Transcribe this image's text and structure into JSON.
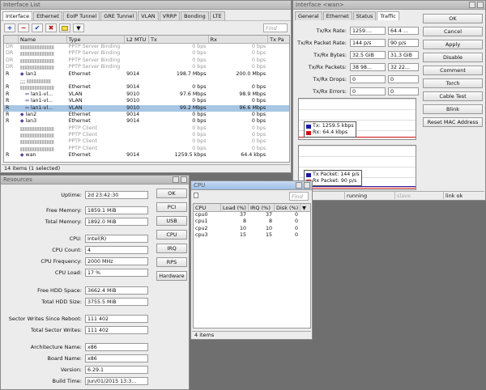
{
  "interface_list": {
    "title": "Interface List",
    "tabs": [
      "Interface",
      "Ethernet",
      "EoIP Tunnel",
      "GRE Tunnel",
      "VLAN",
      "VRRP",
      "Bonding",
      "LTE"
    ],
    "toolbar_icons": [
      "plus-icon",
      "minus-icon",
      "check-icon",
      "x-icon",
      "comment-icon",
      "filter-icon"
    ],
    "find_placeholder": "Find",
    "columns": [
      "Name",
      "Type",
      "L2 MTU",
      "Tx",
      "Rx",
      "Tx Pa"
    ],
    "rows": [
      {
        "flag": "DR",
        "name": "",
        "type": "PPTP Server Binding",
        "mtu": "",
        "tx": "0 bps",
        "rx": "0 bps",
        "blur": true,
        "dim": true
      },
      {
        "flag": "DR",
        "name": "",
        "type": "PPTP Server Binding",
        "mtu": "",
        "tx": "0 bps",
        "rx": "0 bps",
        "blur": true,
        "dim": true
      },
      {
        "flag": "DR",
        "name": "",
        "type": "PPTP Server Binding",
        "mtu": "",
        "tx": "0 bps",
        "rx": "0 bps",
        "blur": true,
        "dim": true
      },
      {
        "flag": "DR",
        "name": "",
        "type": "PPTP Server Binding",
        "mtu": "",
        "tx": "0 bps",
        "rx": "0 bps",
        "blur": true,
        "dim": true
      },
      {
        "flag": "R",
        "name": "lan1",
        "type": "Ethernet",
        "mtu": "9014",
        "tx": "198.7 Mbps",
        "rx": "200.0 Mbps",
        "icon": "ethernet"
      },
      {
        "flag": "",
        "name": ";;;",
        "type": "",
        "mtu": "",
        "tx": "",
        "rx": "",
        "blur": true
      },
      {
        "flag": "R",
        "name": "",
        "type": "Ethernet",
        "mtu": "9014",
        "tx": "0 bps",
        "rx": "0 bps",
        "blur": true
      },
      {
        "flag": "R",
        "name": "lan1-vl...",
        "type": "VLAN",
        "mtu": "9010",
        "tx": "97.6 Mbps",
        "rx": "98.9 Mbps",
        "icon": "vlan"
      },
      {
        "flag": "R",
        "name": "lan1-vl...",
        "type": "VLAN",
        "mtu": "9010",
        "tx": "0 bps",
        "rx": "0 bps",
        "icon": "vlan"
      },
      {
        "flag": "R",
        "name": "lan1-vl...",
        "type": "VLAN",
        "mtu": "9010",
        "tx": "99.2 Mbps",
        "rx": "96.6 Mbps",
        "icon": "vlan",
        "selected": true
      },
      {
        "flag": "R",
        "name": "lan2",
        "type": "Ethernet",
        "mtu": "9014",
        "tx": "0 bps",
        "rx": "0 bps",
        "icon": "ethernet"
      },
      {
        "flag": "R",
        "name": "lan3",
        "type": "Ethernet",
        "mtu": "9014",
        "tx": "0 bps",
        "rx": "0 bps",
        "icon": "ethernet"
      },
      {
        "flag": "",
        "name": "",
        "type": "PPTP Client",
        "mtu": "",
        "tx": "0 bps",
        "rx": "0 bps",
        "blur": true,
        "dim": true
      },
      {
        "flag": "",
        "name": "",
        "type": "PPTP Client",
        "mtu": "",
        "tx": "0 bps",
        "rx": "0 bps",
        "blur": true,
        "dim": true
      },
      {
        "flag": "",
        "name": "",
        "type": "PPTP Client",
        "mtu": "",
        "tx": "0 bps",
        "rx": "0 bps",
        "blur": true,
        "dim": true
      },
      {
        "flag": "",
        "name": "",
        "type": "PPTP Client",
        "mtu": "",
        "tx": "0 bps",
        "rx": "0 bps",
        "blur": true,
        "dim": true
      },
      {
        "flag": "R",
        "name": "wan",
        "type": "Ethernet",
        "mtu": "9014",
        "tx": "1259.5 kbps",
        "rx": "64.4 kbps",
        "icon": "ethernet"
      }
    ],
    "status": "14 items (1 selected)"
  },
  "interface_detail": {
    "title": "Interface <wan>",
    "tabs": [
      "General",
      "Ethernet",
      "Status",
      "Traffic"
    ],
    "fields": [
      {
        "label": "Tx/Rx Rate:",
        "a": "1259....",
        "b": "64.4 ..."
      },
      {
        "label": "Tx/Rx Packet Rate:",
        "a": "144 p/s",
        "b": "90 p/s"
      },
      {
        "label": "Tx/Rx Bytes:",
        "a": "32.5 GiB",
        "b": "31.3 GiB"
      },
      {
        "label": "Tx/Rx Packets:",
        "a": "38 98...",
        "b": "32 22..."
      },
      {
        "label": "Tx/Rx Drops:",
        "a": "0",
        "b": "0"
      },
      {
        "label": "Tx/Rx Errors:",
        "a": "0",
        "b": "0"
      }
    ],
    "buttons": [
      "OK",
      "Cancel",
      "Apply",
      "Disable",
      "Comment",
      "Torch",
      "Cable Test",
      "Blink",
      "Reset MAC Address"
    ],
    "graph1_legend": [
      {
        "label": "Tx:   1259.5 kbps",
        "color": "#1a1aa0"
      },
      {
        "label": "Rx:   64.4 kbps",
        "color": "#d01010"
      }
    ],
    "graph2_legend": [
      {
        "label": "Tx Packet:  144 p/s",
        "color": "#1a1aa0"
      },
      {
        "label": "Rx Packet:  90 p/s",
        "color": "#d01010"
      }
    ],
    "status": [
      "d",
      "running",
      "slave",
      "link ok"
    ]
  },
  "resources": {
    "title": "Resources",
    "fields": [
      {
        "label": "Uptime:",
        "value": "2d 23:42:30"
      },
      {
        "label": "Free Memory:",
        "value": "1859.1 MiB"
      },
      {
        "label": "Total Memory:",
        "value": "1892.0 MiB"
      },
      {
        "label": "CPU:",
        "value": "Intel(R)"
      },
      {
        "label": "CPU Count:",
        "value": "4"
      },
      {
        "label": "CPU Frequency:",
        "value": "2000 MHz"
      },
      {
        "label": "CPU Load:",
        "value": "17 %"
      },
      {
        "label": "Free HDD Space:",
        "value": "3662.4 MiB"
      },
      {
        "label": "Total HDD Size:",
        "value": "3755.5 MiB"
      },
      {
        "label": "Sector Writes Since Reboot:",
        "value": "111 402"
      },
      {
        "label": "Total Sector Writes:",
        "value": "111 402"
      },
      {
        "label": "Architecture Name:",
        "value": "x86"
      },
      {
        "label": "Board Name:",
        "value": "x86"
      },
      {
        "label": "Version:",
        "value": "6.29.1"
      },
      {
        "label": "Build Time:",
        "value": "Jun/01/2015 13:3..."
      }
    ],
    "buttons": [
      "OK",
      "PCI",
      "USB",
      "CPU",
      "IRQ",
      "RPS",
      "Hardware"
    ]
  },
  "cpu": {
    "title": "CPU",
    "find_placeholder": "Find",
    "columns": [
      "CPU",
      "Load (%)",
      "IRQ (%)",
      "Disk (%)"
    ],
    "rows": [
      {
        "cpu": "cpu0",
        "load": "37",
        "irq": "37",
        "disk": "0"
      },
      {
        "cpu": "cpu1",
        "load": "8",
        "irq": "8",
        "disk": "0"
      },
      {
        "cpu": "cpu2",
        "load": "10",
        "irq": "10",
        "disk": "0"
      },
      {
        "cpu": "cpu3",
        "load": "15",
        "irq": "15",
        "disk": "0"
      }
    ],
    "status": "4 items"
  }
}
